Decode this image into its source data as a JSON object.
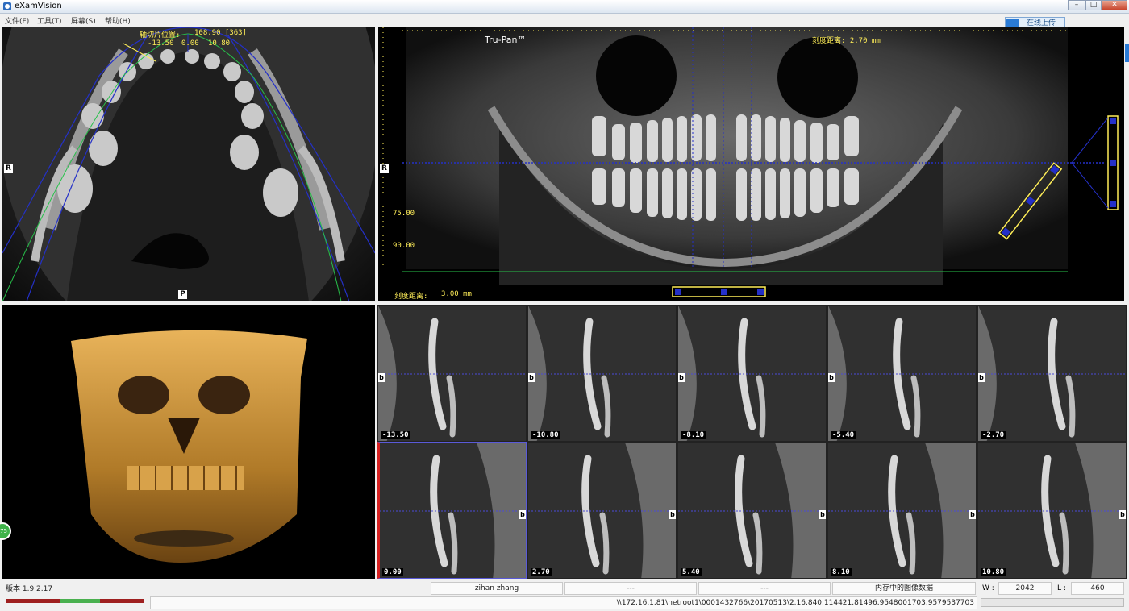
{
  "window": {
    "title": "eXamVision"
  },
  "menu": [
    "文件(F)",
    "工具(T)",
    "屏幕(S)",
    "帮助(H)"
  ],
  "online_button": "在线上传",
  "axial": {
    "header": "轴切片位置:",
    "header_value": "108.90 [363]",
    "marks": [
      "-13.50",
      "0.00",
      "10.80"
    ],
    "orient_left": "R",
    "orient_bottom": "P"
  },
  "panoramic": {
    "brand": "Tru-Pan™",
    "scale_top": "刻度距离: 2.70 mm",
    "scale_bottom_label": "刻度距离:",
    "scale_bottom_value": "3.00 mm",
    "orient_left": "R",
    "ruler_values": [
      "75.00",
      "90.00"
    ]
  },
  "render3d": {
    "badge": "75"
  },
  "slices": {
    "top_row": [
      "-13.50",
      "-10.80",
      "-8.10",
      "-5.40",
      "-2.70"
    ],
    "bottom_row": [
      "0.00",
      "2.70",
      "5.40",
      "8.10",
      "10.80"
    ],
    "marker": "b"
  },
  "status": {
    "version": "版本 1.9.2.17",
    "user": "zihan zhang",
    "field2": "---",
    "field3": "---",
    "memory": "内存中的图像数据",
    "w_label": "W :",
    "w_value": "2042",
    "l_label": "L :",
    "l_value": "460",
    "path": "\\\\172.16.1.81\\netroot1\\0001432766\\20170513\\2.16.840.114421.81496.9548001703.9579537703"
  },
  "colors": {
    "accent": "#2a7bd6",
    "overlay_yellow": "#ffee58",
    "curve_blue": "#2430c8",
    "curve_green": "#27c04a",
    "bone_gold": "#c8933a"
  }
}
